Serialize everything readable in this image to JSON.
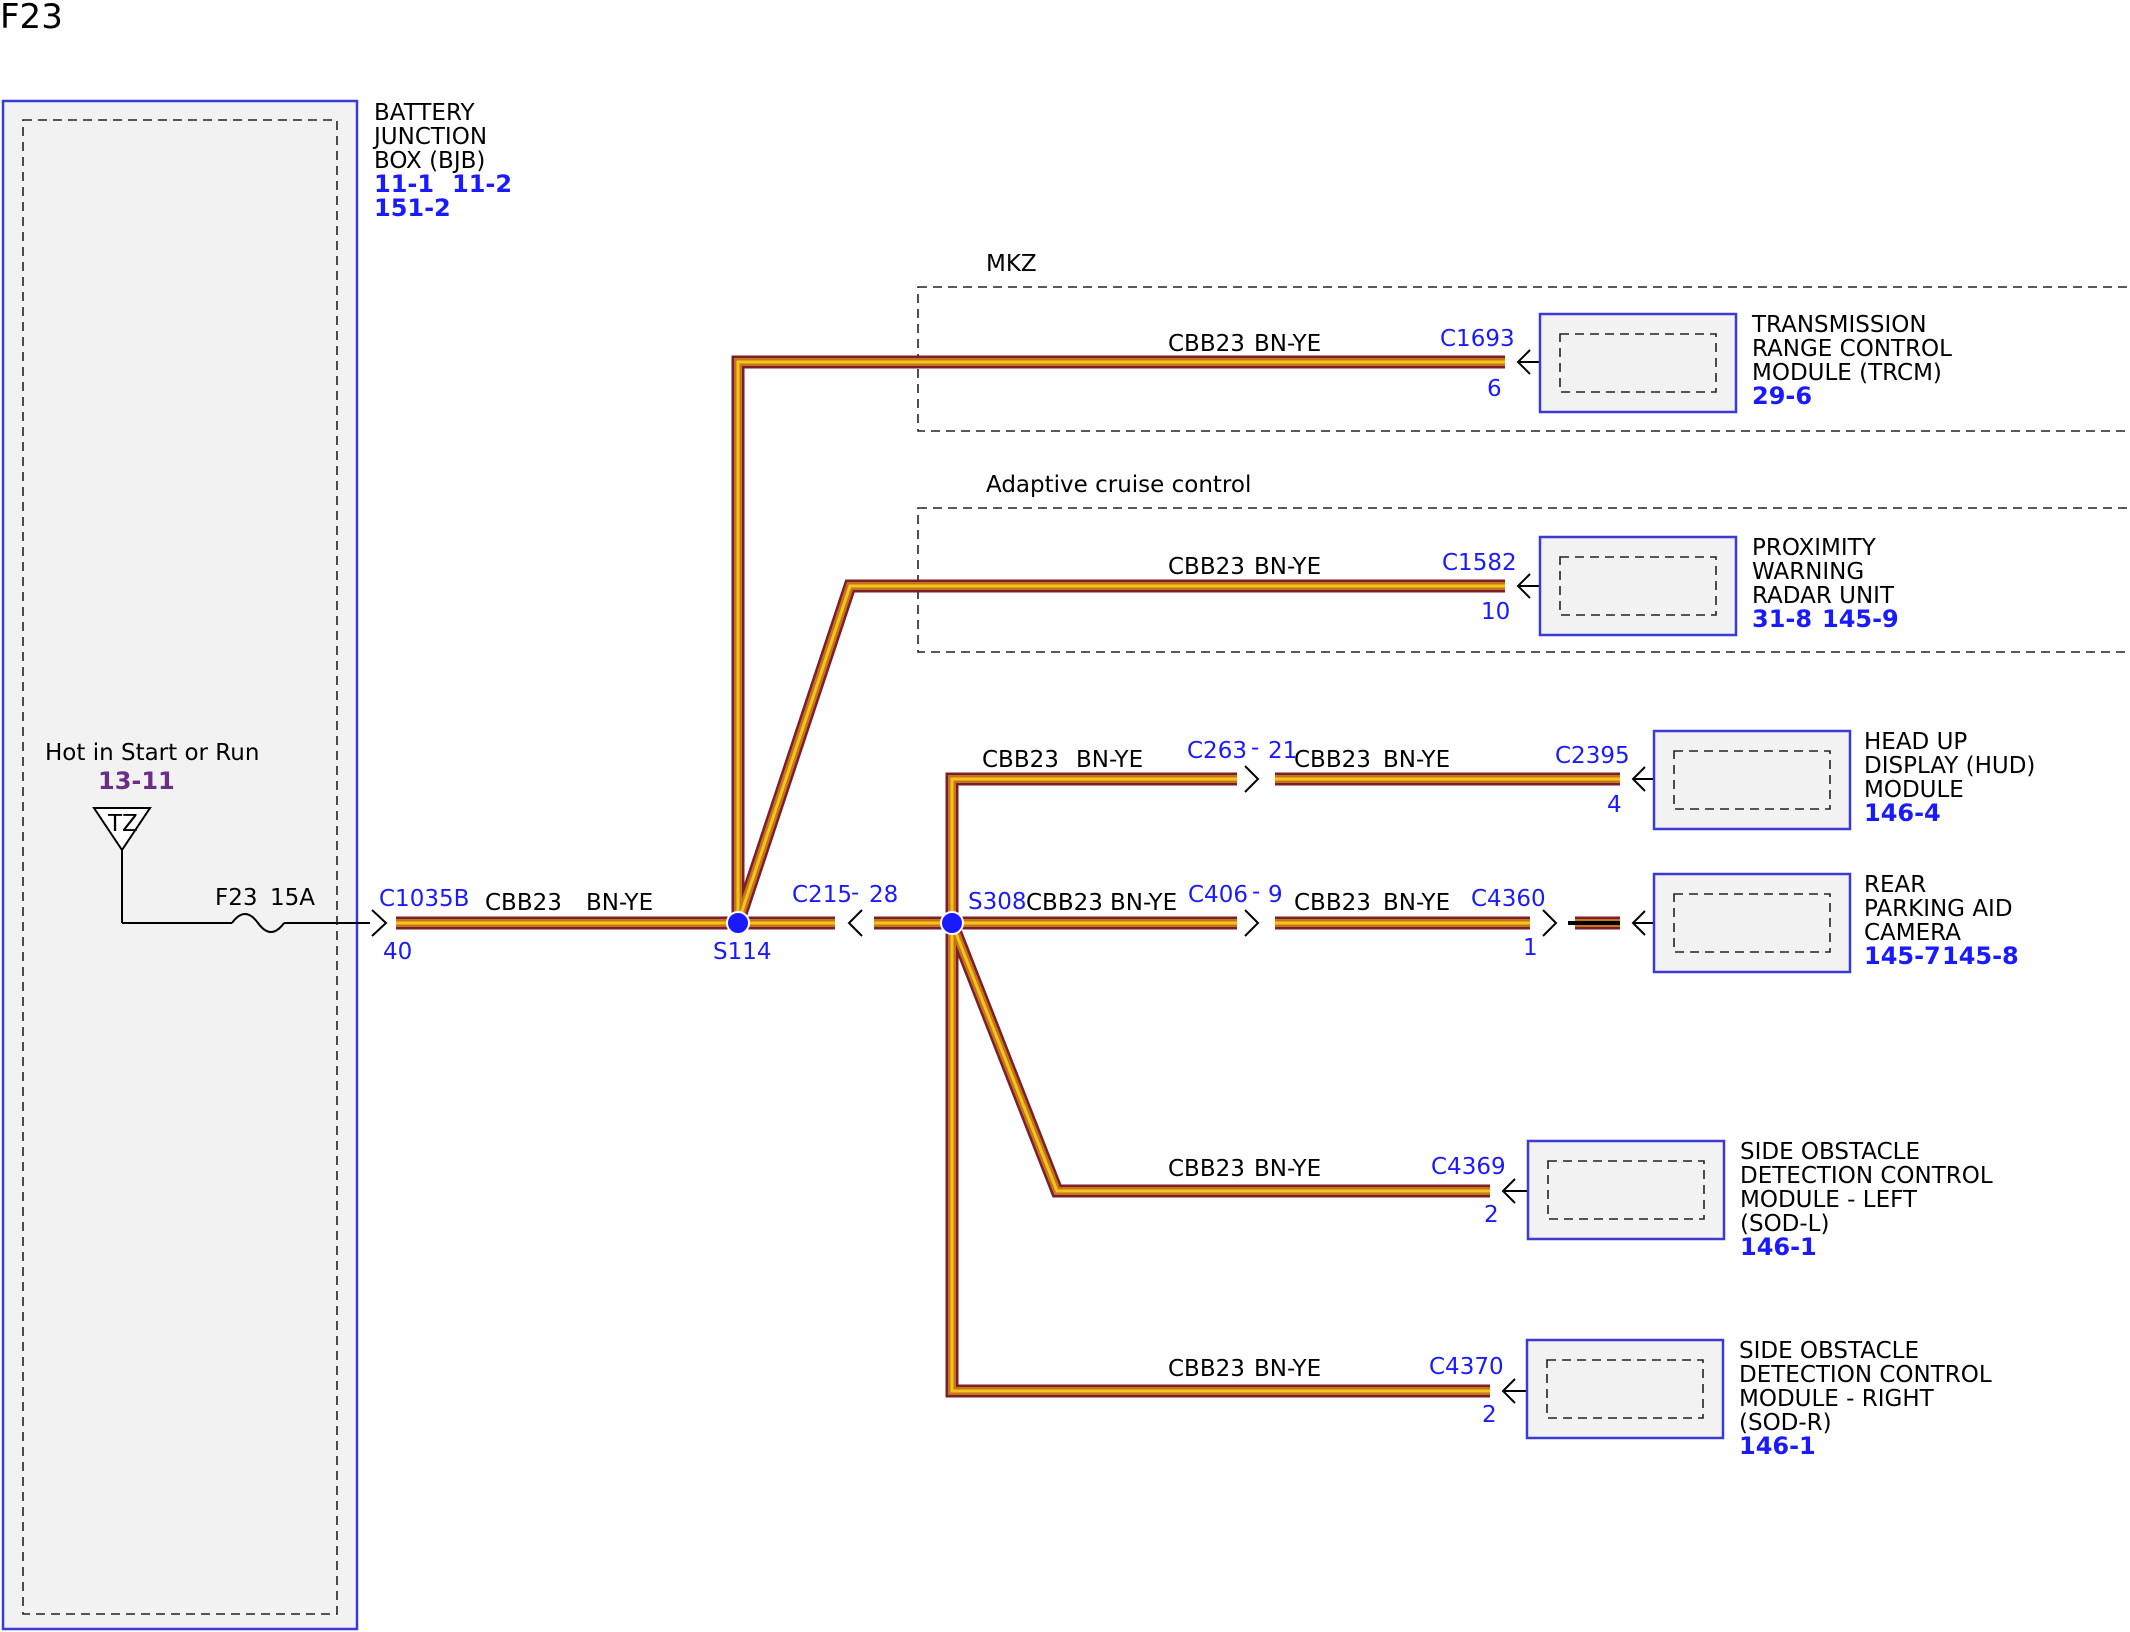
{
  "page_title": "F23",
  "bjb": {
    "lines": [
      "BATTERY",
      "JUNCTION",
      "BOX (BJB)"
    ],
    "refs": [
      "11-1",
      "11-2",
      "151-2"
    ]
  },
  "supply": {
    "label": "Hot in Start or Run",
    "ref": "13-11",
    "symbol": "TZ",
    "fuse": "F23",
    "rating": "15A"
  },
  "connectors": {
    "c1035b": "C1035B",
    "c1035b_pin": "40",
    "c215": "C215",
    "c215_dash": "-",
    "c215_pin": "28",
    "c263": "C263",
    "c263_dash": "-",
    "c263_pin": "21",
    "c406": "C406",
    "c406_dash": "-",
    "c406_pin": "9",
    "c1693": "C1693",
    "c1693_pin": "6",
    "c1582": "C1582",
    "c1582_pin": "10",
    "c2395": "C2395",
    "c2395_pin": "4",
    "c4360": "C4360",
    "c4360_pin": "1",
    "c4369": "C4369",
    "c4369_pin": "2",
    "c4370": "C4370",
    "c4370_pin": "2"
  },
  "splices": {
    "s114": "S114",
    "s308": "S308"
  },
  "wire": {
    "circuit": "CBB23",
    "color": "BN-YE"
  },
  "regions": {
    "mkz": "MKZ",
    "acc": "Adaptive cruise control"
  },
  "modules": {
    "trcm": {
      "lines": [
        "TRANSMISSION",
        "RANGE CONTROL",
        "MODULE (TRCM)"
      ],
      "refs": [
        "29-6"
      ]
    },
    "radar": {
      "lines": [
        "PROXIMITY",
        "WARNING",
        "RADAR UNIT"
      ],
      "refs": [
        "31-8",
        "145-9"
      ]
    },
    "hud": {
      "lines": [
        "HEAD UP",
        "DISPLAY (HUD)",
        "MODULE"
      ],
      "refs": [
        "146-4"
      ]
    },
    "camera": {
      "lines": [
        "REAR",
        "PARKING AID",
        "CAMERA"
      ],
      "refs": [
        "145-7",
        "145-8"
      ]
    },
    "sodl": {
      "lines": [
        "SIDE OBSTACLE",
        "DETECTION CONTROL",
        "MODULE - LEFT",
        "(SOD-L)"
      ],
      "refs": [
        "146-1"
      ]
    },
    "sodr": {
      "lines": [
        "SIDE OBSTACLE",
        "DETECTION CONTROL",
        "MODULE - RIGHT",
        "(SOD-R)"
      ],
      "refs": [
        "146-1"
      ]
    }
  },
  "colors": {
    "wire_outer": "#7a1f2b",
    "wire_mid": "#c8741a",
    "wire_core": "#f0c61a",
    "box_border": "#3a3ad6",
    "box_fill": "#f2f2f2",
    "connector_text": "#1a1aff",
    "reference_text": "#1a1aff",
    "supply_reference": "#6b2d86",
    "splice_dot": "#1a1aff"
  }
}
